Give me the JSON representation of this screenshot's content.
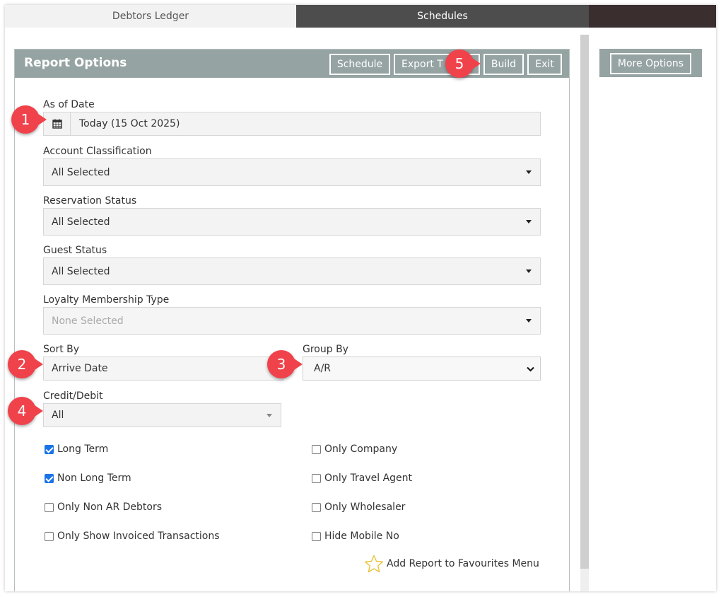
{
  "tabs": {
    "ledger": "Debtors Ledger",
    "schedules": "Schedules"
  },
  "panel": {
    "title": "Report Options",
    "buttons": {
      "schedule": "Schedule",
      "export": "Export T",
      "build": "Build",
      "exit": "Exit"
    }
  },
  "right_panel": {
    "more_options": "More Options"
  },
  "form": {
    "as_of_date": {
      "label": "As of Date",
      "value": "Today (15 Oct 2025)",
      "icon": "calendar-icon"
    },
    "account_classification": {
      "label": "Account Classification",
      "value": "All Selected"
    },
    "reservation_status": {
      "label": "Reservation Status",
      "value": "All Selected"
    },
    "guest_status": {
      "label": "Guest Status",
      "value": "All Selected"
    },
    "loyalty_membership_type": {
      "label": "Loyalty Membership Type",
      "value": "None Selected"
    },
    "sort_by": {
      "label": "Sort By",
      "value": "Arrive Date"
    },
    "group_by": {
      "label": "Group By",
      "value": "A/R"
    },
    "credit_debit": {
      "label": "Credit/Debit",
      "value": "All"
    }
  },
  "checkboxes": {
    "long_term": {
      "label": "Long Term",
      "checked": true
    },
    "non_long_term": {
      "label": "Non Long Term",
      "checked": true
    },
    "only_non_ar_debtors": {
      "label": "Only Non AR Debtors",
      "checked": false
    },
    "only_show_invoiced": {
      "label": "Only Show Invoiced Transactions",
      "checked": false
    },
    "only_company": {
      "label": "Only Company",
      "checked": false
    },
    "only_travel_agent": {
      "label": "Only Travel Agent",
      "checked": false
    },
    "only_wholesaler": {
      "label": "Only Wholesaler",
      "checked": false
    },
    "hide_mobile_no": {
      "label": "Hide Mobile No",
      "checked": false
    }
  },
  "favourites": {
    "label": "Add Report to Favourites Menu",
    "icon": "star-outline-icon"
  },
  "callouts": [
    "1",
    "2",
    "3",
    "4",
    "5"
  ],
  "colors": {
    "header": "#96a3a3",
    "callout": "#f0424b",
    "checkbox": "#1a73e8",
    "active_tab": "#4d4d4d"
  }
}
